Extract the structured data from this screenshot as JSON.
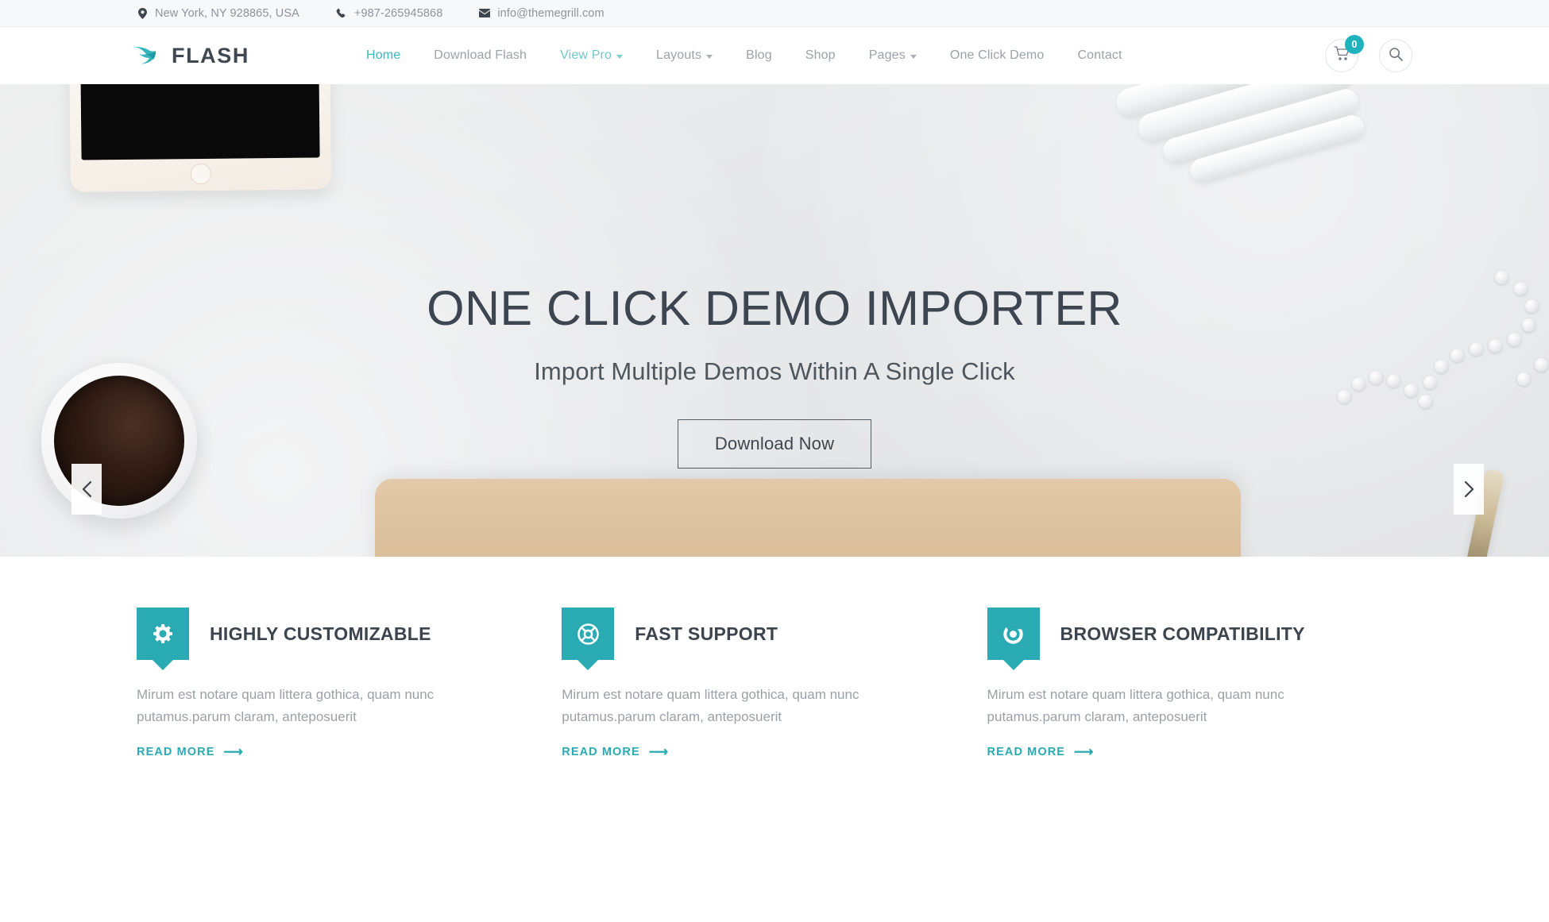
{
  "topbar": {
    "address": "New York, NY 928865, USA",
    "phone": "+987-265945868",
    "email": "info@themegrill.com"
  },
  "header": {
    "brand_name": "FLASH",
    "nav": [
      {
        "label": "Home",
        "active": true,
        "caret": false
      },
      {
        "label": "Download Flash",
        "active": false,
        "caret": false
      },
      {
        "label": "View Pro",
        "active": false,
        "caret": true
      },
      {
        "label": "Layouts",
        "active": false,
        "caret": true
      },
      {
        "label": "Blog",
        "active": false,
        "caret": false
      },
      {
        "label": "Shop",
        "active": false,
        "caret": false
      },
      {
        "label": "Pages",
        "active": false,
        "caret": true
      },
      {
        "label": "One Click Demo",
        "active": false,
        "caret": false
      },
      {
        "label": "Contact",
        "active": false,
        "caret": false
      }
    ],
    "cart_count": "0"
  },
  "hero": {
    "title": "ONE CLICK DEMO IMPORTER",
    "subtitle": "Import Multiple Demos Within A Single Click",
    "button_label": "Download Now",
    "prev_label": "‹",
    "next_label": "›"
  },
  "features": [
    {
      "icon": "gear-icon",
      "title": "HIGHLY CUSTOMIZABLE",
      "text": "Mirum est notare quam littera gothica, quam nunc putamus.parum claram, anteposuerit",
      "read_more": "READ MORE"
    },
    {
      "icon": "lifebuoy-icon",
      "title": "FAST SUPPORT",
      "text": "Mirum est notare quam littera gothica, quam nunc putamus.parum claram, anteposuerit",
      "read_more": "READ MORE"
    },
    {
      "icon": "browser-chrome-icon",
      "title": "BROWSER COMPATIBILITY",
      "text": "Mirum est notare quam littera gothica, quam nunc putamus.parum claram, anteposuerit",
      "read_more": "READ MORE"
    }
  ],
  "colors": {
    "accent": "#2aaab3",
    "accent_light": "#3fb5bd",
    "text_dark": "#3c444d",
    "text_muted": "#9aa1a7",
    "topbar_bg": "#f6f8fa",
    "hero_bg": "#e9eaec"
  }
}
